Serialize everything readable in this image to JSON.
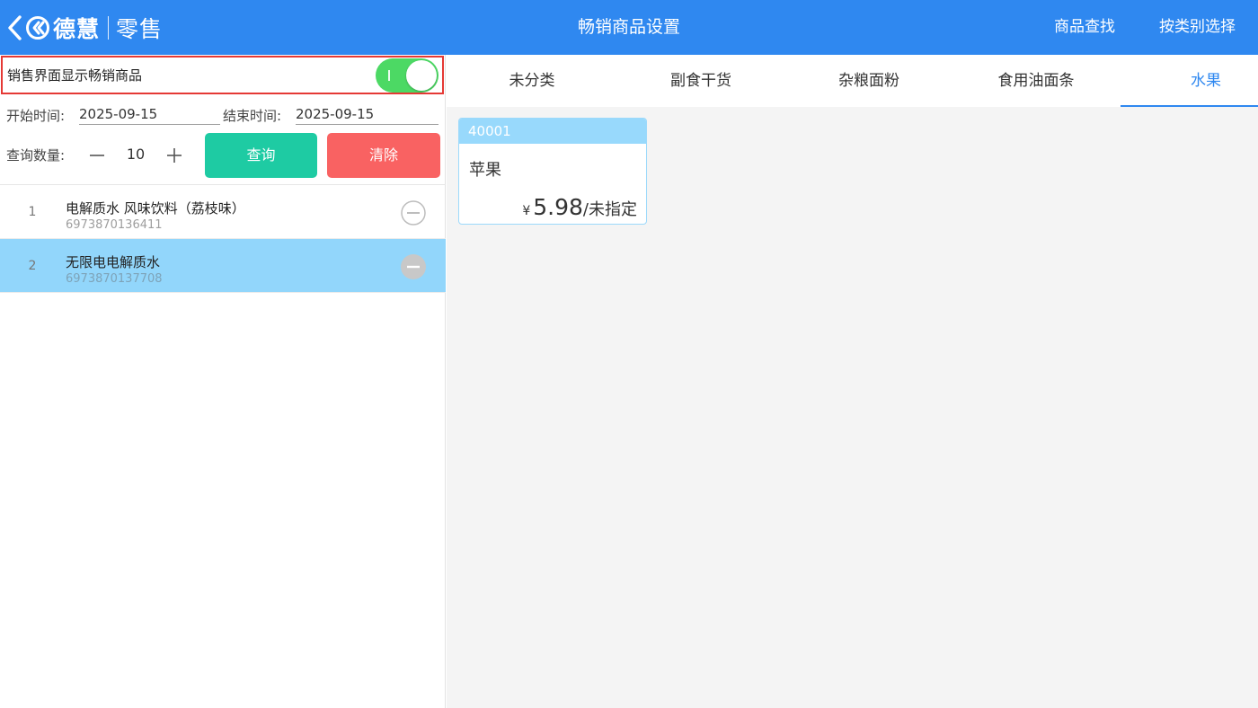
{
  "header": {
    "brand": "德慧",
    "sub": "零售",
    "title": "畅销商品设置",
    "find_label": "商品查找",
    "category_label": "按类别选择"
  },
  "filters": {
    "toggle_label": "销售界面显示畅销商品",
    "toggle_on": true,
    "start_label": "开始时间:",
    "start_value": "2025-09-15",
    "end_label": "结束时间:",
    "end_value": "2025-09-15",
    "qty_label": "查询数量:",
    "qty_value": "10",
    "query_label": "查询",
    "clear_label": "清除"
  },
  "list": [
    {
      "index": "1",
      "name": "电解质水 风味饮料（荔枝味）",
      "code": "6973870136411",
      "selected": false
    },
    {
      "index": "2",
      "name": "无限电电解质水",
      "code": "6973870137708",
      "selected": true
    }
  ],
  "tabs": [
    {
      "label": "未分类"
    },
    {
      "label": "副食干货"
    },
    {
      "label": "杂粮面粉"
    },
    {
      "label": "食用油面条"
    },
    {
      "label": "水果",
      "active": true
    }
  ],
  "products": [
    {
      "code": "40001",
      "name": "苹果",
      "currency": "¥",
      "price": "5.98",
      "unit": "/未指定"
    }
  ],
  "colors": {
    "header": "#2f88f0",
    "toggle_on": "#4cd964",
    "query_button": "#1ecba3",
    "clear_button": "#f96262",
    "selected_row": "#92d6fb",
    "highlight_border": "#e53935"
  },
  "icons": {
    "back": "chevron-left-icon",
    "logo": "logo-icon",
    "decrement": "minus-icon",
    "increment": "plus-icon",
    "remove": "remove-circle-icon"
  }
}
